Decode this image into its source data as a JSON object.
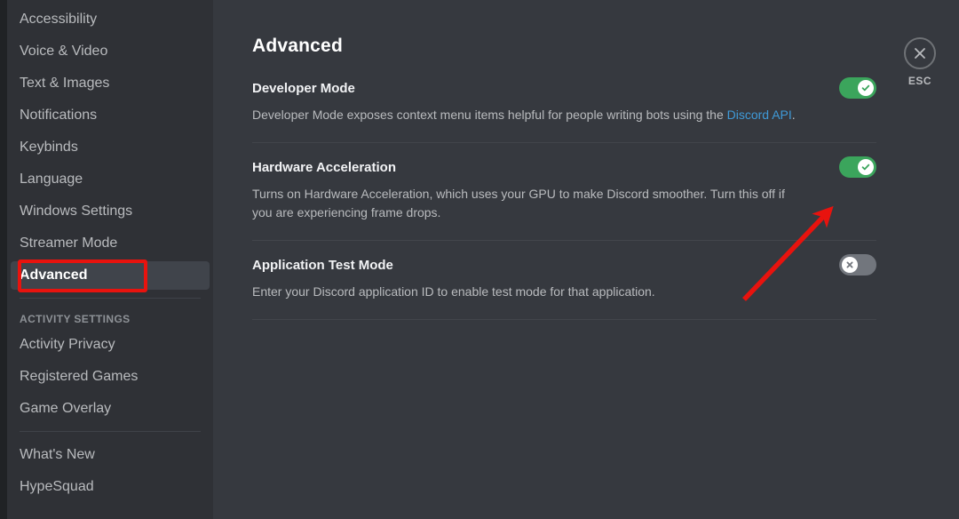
{
  "sidebar": {
    "items": [
      {
        "label": "Accessibility",
        "type": "item",
        "selected": false
      },
      {
        "label": "Voice & Video",
        "type": "item",
        "selected": false
      },
      {
        "label": "Text & Images",
        "type": "item",
        "selected": false
      },
      {
        "label": "Notifications",
        "type": "item",
        "selected": false
      },
      {
        "label": "Keybinds",
        "type": "item",
        "selected": false
      },
      {
        "label": "Language",
        "type": "item",
        "selected": false
      },
      {
        "label": "Windows Settings",
        "type": "item",
        "selected": false
      },
      {
        "label": "Streamer Mode",
        "type": "item",
        "selected": false
      },
      {
        "label": "Advanced",
        "type": "item",
        "selected": true
      },
      {
        "label": "",
        "type": "separator"
      },
      {
        "label": "ACTIVITY SETTINGS",
        "type": "header"
      },
      {
        "label": "Activity Privacy",
        "type": "item",
        "selected": false
      },
      {
        "label": "Registered Games",
        "type": "item",
        "selected": false
      },
      {
        "label": "Game Overlay",
        "type": "item",
        "selected": false
      },
      {
        "label": "",
        "type": "separator"
      },
      {
        "label": "What's New",
        "type": "item",
        "selected": false
      },
      {
        "label": "HypeSquad",
        "type": "item",
        "selected": false
      }
    ]
  },
  "main": {
    "title": "Advanced",
    "settings": [
      {
        "title": "Developer Mode",
        "desc_before": "Developer Mode exposes context menu items helpful for people writing bots using the ",
        "link": "Discord API",
        "desc_after": ".",
        "toggle": "on"
      },
      {
        "title": "Hardware Acceleration",
        "desc_before": "Turns on Hardware Acceleration, which uses your GPU to make Discord smoother. Turn this off if you are experiencing frame drops.",
        "link": "",
        "desc_after": "",
        "toggle": "on"
      },
      {
        "title": "Application Test Mode",
        "desc_before": "Enter your Discord application ID to enable test mode for that application.",
        "link": "",
        "desc_after": "",
        "toggle": "off"
      }
    ]
  },
  "close": {
    "label": "ESC",
    "icon": "close-x-icon"
  },
  "colors": {
    "accent_green": "#3ba55c",
    "toggle_off": "#72767d",
    "link_blue": "#3f9ad8",
    "annotation_red": "#e8130e",
    "sidebar_bg": "#2f3136",
    "content_bg": "#36393f",
    "selected_bg": "#40444b"
  },
  "annotations": {
    "highlight_box_target": "sidebar-item-advanced",
    "arrow_target": "hardware-acceleration-toggle"
  }
}
